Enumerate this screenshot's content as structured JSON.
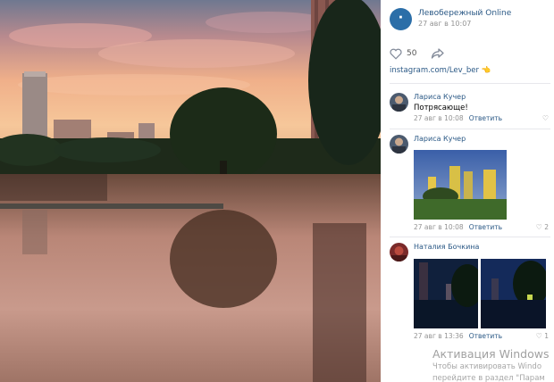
{
  "post": {
    "group_name": "Левобережный Online",
    "date": "27 авг в 10:07",
    "likes": "50",
    "link_text": "instagram.com/Lev_ber",
    "emoji": "👈"
  },
  "comments": [
    {
      "author": "Лариса Кучер",
      "text": "Потрясающе!",
      "time": "27 авг в 10:08",
      "reply": "Ответить",
      "likes": ""
    },
    {
      "author": "Лариса Кучер",
      "text": "",
      "time": "27 авг в 10:08",
      "reply": "Ответить",
      "likes": "2"
    },
    {
      "author": "Наталия Бочкина",
      "text": "",
      "time": "27 авг в 13:36",
      "reply": "Ответить",
      "likes": "1"
    }
  ],
  "watermark": {
    "title": "Активация Windows",
    "line1": "Чтобы активировать Windo",
    "line2": "перейдите в раздел \"Парам"
  },
  "colors": {
    "link": "#2a5885",
    "meta": "#939393",
    "brand": "#2b6ea8"
  },
  "icons": [
    "heart-icon",
    "share-arrow-icon",
    "pointing-hand-emoji"
  ]
}
